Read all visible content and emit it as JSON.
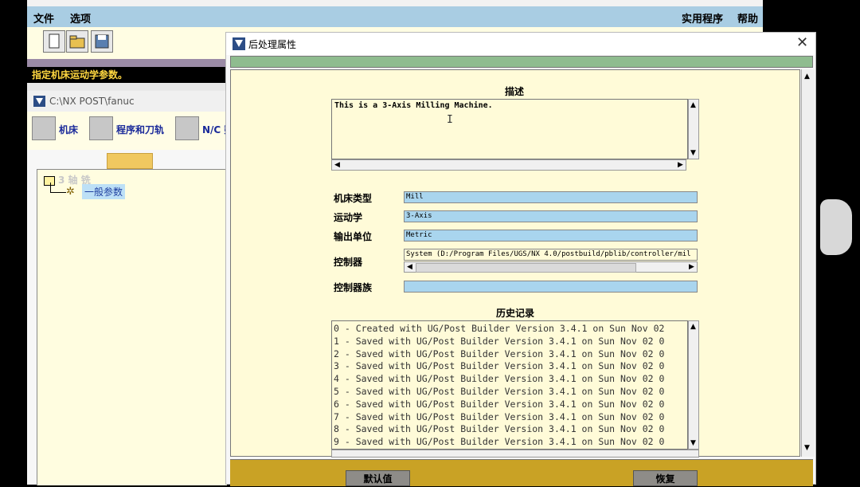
{
  "main_window": {
    "menu": {
      "file": "文件",
      "options": "选项",
      "utilities": "实用程序",
      "help": "帮助"
    },
    "status": "指定机床运动学参数。",
    "sub_window": {
      "title": "C:\\NX POST\\fanuc",
      "tabs": [
        {
          "label": "机床"
        },
        {
          "label": "程序和刀轨"
        },
        {
          "label": "N/C 数"
        }
      ],
      "tree": {
        "root": "3 轴 铣",
        "child": "一般参数"
      }
    }
  },
  "dialog": {
    "title": "后处理属性",
    "close_glyph": "✕",
    "description": {
      "label": "描述",
      "text": "This is a 3-Axis Milling Machine."
    },
    "fields": {
      "machine_type": {
        "label": "机床类型",
        "value": "Mill"
      },
      "kinematics": {
        "label": "运动学",
        "value": "3-Axis"
      },
      "output_unit": {
        "label": "输出单位",
        "value": "Metric"
      },
      "controller": {
        "label": "控制器",
        "value": "System (D:/Program Files/UGS/NX 4.0/postbuild/pblib/controller/mil"
      },
      "controller_family": {
        "label": "控制器族",
        "value": ""
      }
    },
    "history": {
      "label": "历史记录",
      "entries": [
        "0 - Created with UG/Post Builder Version 3.4.1 on Sun Nov 02",
        "1 - Saved with UG/Post Builder Version 3.4.1 on Sun Nov 02 0",
        "2 - Saved with UG/Post Builder Version 3.4.1 on Sun Nov 02 0",
        "3 - Saved with UG/Post Builder Version 3.4.1 on Sun Nov 02 0",
        "4 - Saved with UG/Post Builder Version 3.4.1 on Sun Nov 02 0",
        "5 - Saved with UG/Post Builder Version 3.4.1 on Sun Nov 02 0",
        "6 - Saved with UG/Post Builder Version 3.4.1 on Sun Nov 02 0",
        "7 - Saved with UG/Post Builder Version 3.4.1 on Sun Nov 02 0",
        "8 - Saved with UG/Post Builder Version 3.4.1 on Sun Nov 02 0",
        "9 - Saved with UG/Post Builder Version 3.4.1 on Sun Nov 02 0"
      ]
    },
    "buttons": {
      "default": "默认值",
      "restore": "恢复"
    }
  }
}
